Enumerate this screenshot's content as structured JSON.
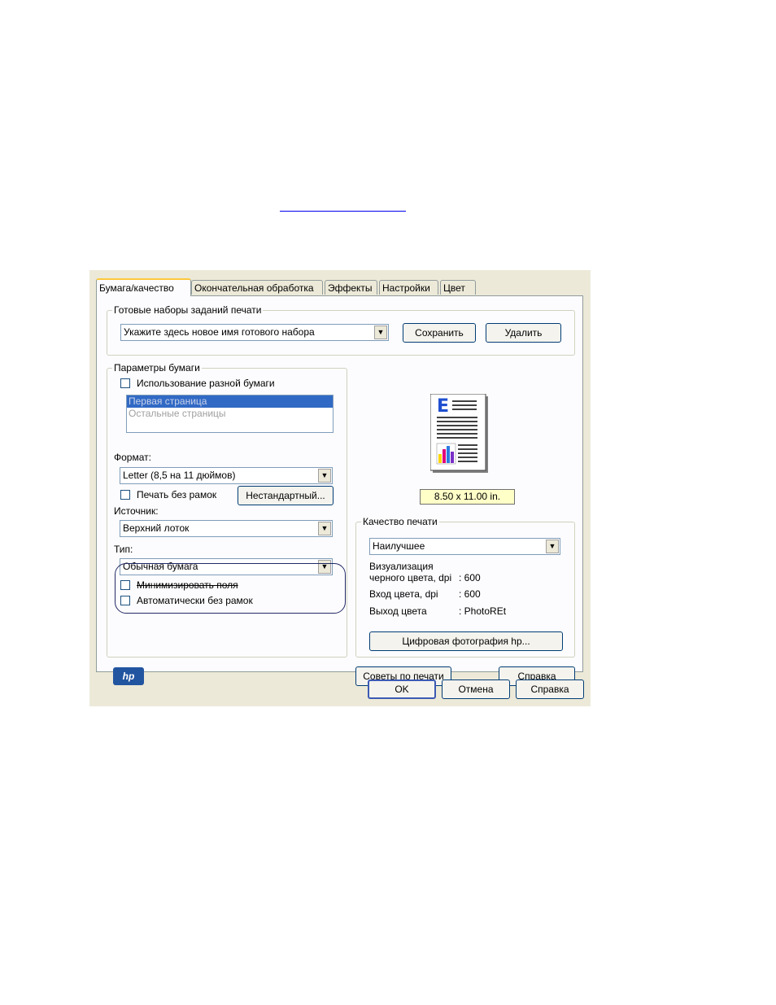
{
  "tabs": [
    "Бумага/качество",
    "Окончательная обработка",
    "Эффекты",
    "Настройки",
    "Цвет"
  ],
  "presets": {
    "title": "Готовые наборы заданий печати",
    "name_value": "Укажите здесь новое имя готового набора",
    "save_button": "Сохранить",
    "delete_button": "Удалить"
  },
  "paper": {
    "title": "Параметры бумаги",
    "mixed_paper_label": "Использование разной бумаги",
    "page_list": [
      "Первая страница",
      "Остальные страницы"
    ],
    "format_label": "Формат:",
    "format_value": "Letter (8,5 на 11 дюймов)",
    "borderless_label": "Печать без рамок",
    "custom_button": "Нестандартный...",
    "source_label": "Источник:",
    "source_value": "Верхний лоток",
    "type_label": "Тип:",
    "type_value": "Обычная бумага",
    "minimize_margins_label": "Минимизировать поля",
    "auto_borderless_label": "Автоматически без рамок"
  },
  "preview": {
    "size_label": "8.50 x 11.00 in.",
    "page_letter": "E"
  },
  "quality": {
    "title": "Качество печати",
    "value": "Наилучшее",
    "rows": [
      {
        "label": "Визуализация",
        "value": ""
      },
      {
        "label": "черного цвета, dpi",
        "value": ": 600"
      },
      {
        "label": "Вход цвета, dpi",
        "value": ": 600"
      },
      {
        "label": "Выход цвета",
        "value": ": PhotoREt"
      }
    ],
    "digital_photo_button": "Цифровая фотография hp..."
  },
  "footer": {
    "logo": "hp",
    "tips_button": "Советы по печати",
    "help_button": "Справка"
  },
  "dialog_buttons": {
    "ok": "OK",
    "cancel": "Отмена",
    "help": "Справка"
  }
}
